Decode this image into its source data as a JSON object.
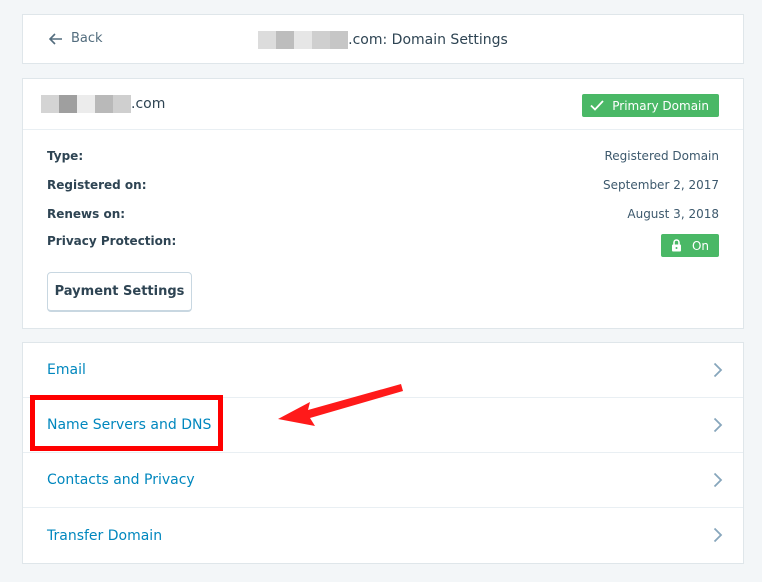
{
  "header": {
    "back_label": "Back",
    "title_suffix": ".com: Domain Settings"
  },
  "domain": {
    "name_suffix": ".com",
    "primary_badge": "Primary Domain"
  },
  "details": [
    {
      "label": "Type:",
      "value": "Registered Domain"
    },
    {
      "label": "Registered on:",
      "value": "September 2, 2017"
    },
    {
      "label": "Renews on:",
      "value": "August 3, 2018"
    },
    {
      "label": "Privacy Protection:",
      "value": ""
    }
  ],
  "privacy_toggle": "On",
  "payment_button": "Payment Settings",
  "nav": [
    {
      "label": "Email"
    },
    {
      "label": "Name Servers and DNS"
    },
    {
      "label": "Contacts and Privacy"
    },
    {
      "label": "Transfer Domain"
    }
  ],
  "colors": {
    "link": "#0087be",
    "success": "#4ab866",
    "annotation": "#ff0000"
  },
  "icons": [
    "back-arrow-icon",
    "checkmark-icon",
    "lock-icon",
    "chevron-right-icon"
  ]
}
